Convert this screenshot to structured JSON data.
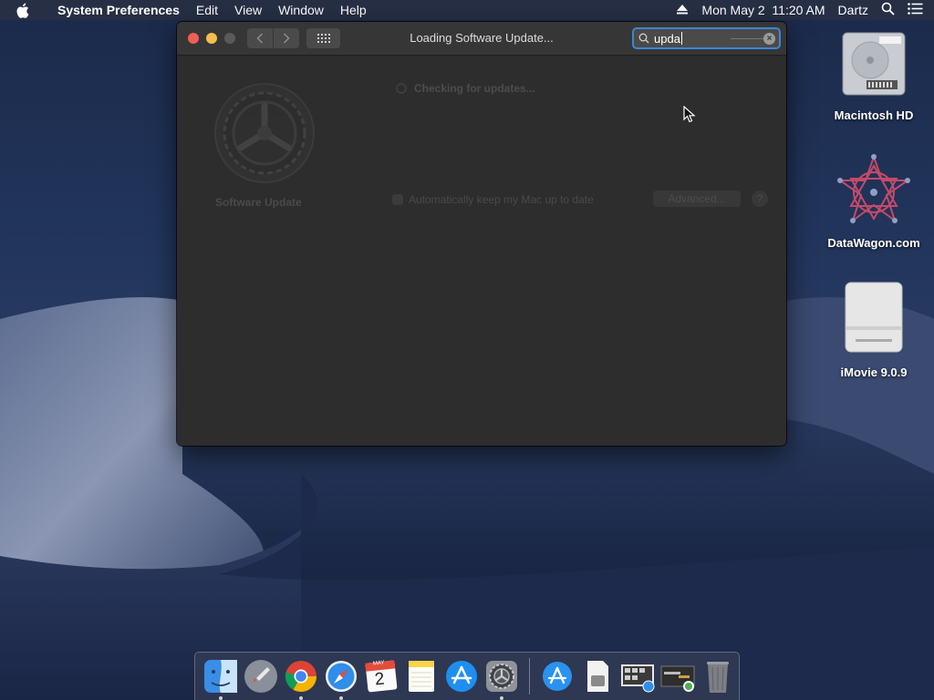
{
  "menubar": {
    "app_name": "System Preferences",
    "menus": [
      "Edit",
      "View",
      "Window",
      "Help"
    ],
    "datetime": "Mon May 2  11:20 AM",
    "user": "Dartz"
  },
  "window": {
    "title": "Loading Software Update...",
    "search_value": "upda",
    "pane_label": "Software Update",
    "checking_text": "Checking for updates...",
    "auto_update_text": "Automatically keep my Mac up to date",
    "advanced_label": "Advanced...",
    "help_label": "?"
  },
  "desktop_icons": [
    {
      "label": "Macintosh HD",
      "icon": "hard-drive-icon"
    },
    {
      "label": "DataWagon.com",
      "icon": "datawagon-icon"
    },
    {
      "label": "iMovie 9.0.9",
      "icon": "disk-image-icon"
    }
  ],
  "dock": {
    "apps": [
      "finder-icon",
      "launchpad-icon",
      "chrome-icon",
      "safari-icon",
      "calendar-icon",
      "notes-icon",
      "app-store-icon",
      "system-preferences-icon"
    ],
    "others": [
      "app-store-folder-icon",
      "document-icon",
      "screenshot-stack-icon",
      "screenshot-stack-2-icon",
      "trash-icon"
    ],
    "calendar_month": "MAY",
    "calendar_day": "2"
  },
  "colors": {
    "close": "#ed5f57",
    "minimize": "#f4bd4f",
    "search_focus": "#3c86d6"
  }
}
